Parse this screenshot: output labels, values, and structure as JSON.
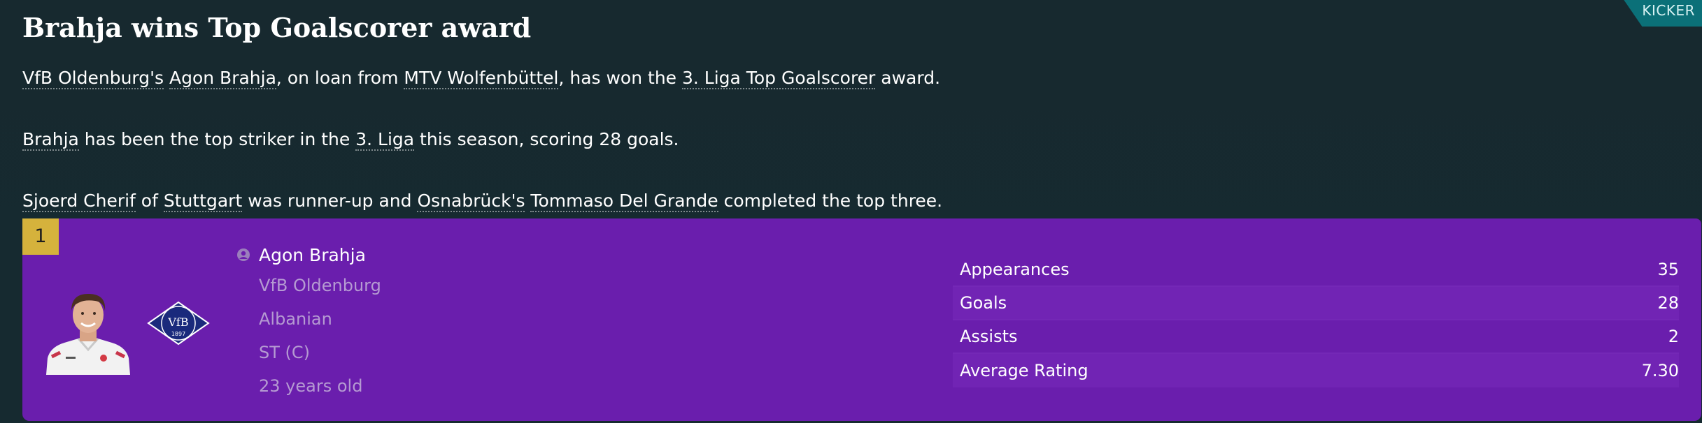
{
  "source": {
    "label": "KICKER"
  },
  "headline": "Brahja wins Top Goalscorer award",
  "paragraphs": {
    "p1": {
      "club": "VfB Oldenburg's",
      "space1": " ",
      "player": "Agon Brahja",
      "text1": ", on loan from ",
      "loan_club": "MTV Wolfenbüttel",
      "text2": ", has won the ",
      "competition": "3. Liga Top Goalscorer",
      "text3": " award."
    },
    "p2": {
      "player": "Brahja",
      "text1": " has been the top striker in the ",
      "competition": "3. Liga",
      "text2": " this season, scoring 28 goals."
    },
    "p3": {
      "runner_up": "Sjoerd Cherif",
      "text1": " of ",
      "runner_up_club": "Stuttgart",
      "text2": " was runner-up and ",
      "third_club": "Osnabrück's",
      "space1": " ",
      "third": "Tommaso Del Grande",
      "text3": " completed the top three."
    }
  },
  "award_card": {
    "rank": "1",
    "player": {
      "name": "Agon Brahja",
      "club": "VfB Oldenburg",
      "nationality": "Albanian",
      "position": "ST (C)",
      "age": "23 years old"
    },
    "crest": {
      "text": "VfB",
      "year": "1897"
    },
    "stats": [
      {
        "label": "Appearances",
        "value": "35"
      },
      {
        "label": "Goals",
        "value": "28"
      },
      {
        "label": "Assists",
        "value": "2"
      },
      {
        "label": "Average Rating",
        "value": "7.30"
      }
    ]
  },
  "colors": {
    "background": "#17282f",
    "card": "#6a1ead",
    "rank_badge": "#d5b23c",
    "source_tag": "#0b7078",
    "muted_text": "#b59ad2"
  }
}
